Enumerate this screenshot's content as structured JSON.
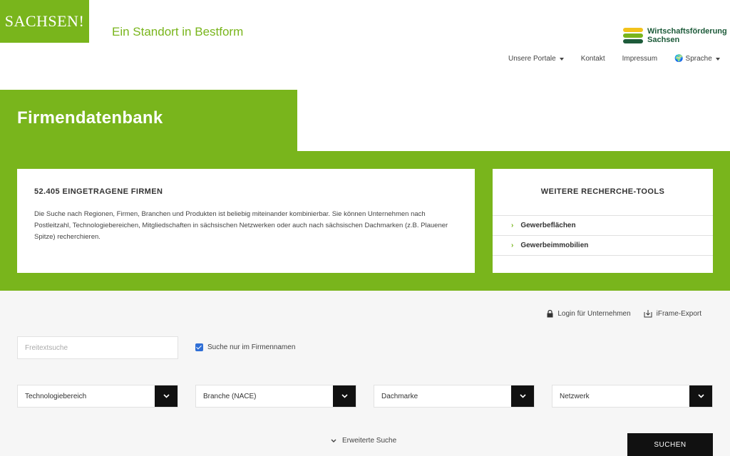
{
  "header": {
    "logo_text": "SACHSEN!",
    "tagline": "Ein Standort in Bestform",
    "brand_line1": "Wirtschaftsförderung",
    "brand_line2": "Sachsen",
    "brand_colors": [
      "#f2c21b",
      "#79b51c",
      "#1d5b3a"
    ]
  },
  "nav": {
    "items": [
      "Unsere Portale",
      "Kontakt",
      "Impressum",
      "Sprache"
    ]
  },
  "page": {
    "title": "Firmendatenbank",
    "accent_color": "#79b51c"
  },
  "intro": {
    "heading": "52.405 EINGETRAGENE FIRMEN",
    "text": "Die Suche nach Regionen, Firmen, Branchen und Produkten ist beliebig miteinander kombinierbar. Sie können Unternehmen nach Postleitzahl, Technologiebereichen, Mitgliedschaften in sächsischen Netzwerken oder auch nach sächsischen Dachmarken (z.B. Plauener Spitze) recherchieren."
  },
  "tools": {
    "heading": "WEITERE RECHERCHE-TOOLS",
    "links": [
      "Gewerbeflächen",
      "Gewerbeimmobilien"
    ]
  },
  "utility": {
    "login": "Login für Unternehmen",
    "export": "iFrame-Export"
  },
  "search": {
    "placeholder": "Freitextsuche",
    "checkbox_label": "Suche nur im Firmennamen",
    "checkbox_checked": true,
    "selects": [
      "Technologiebereich",
      "Branche (NACE)",
      "Dachmarke",
      "Netzwerk"
    ],
    "advanced_label": "Erweiterte Suche",
    "submit_label": "SUCHEN"
  }
}
